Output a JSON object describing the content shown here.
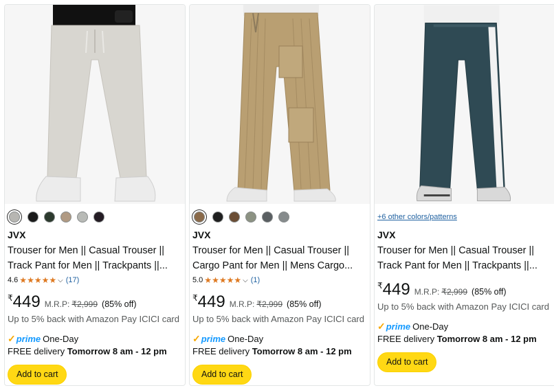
{
  "products": [
    {
      "brand": "JVX",
      "title": "Trouser for Men || Casual Trouser || Track Pant for Men || Trackpants ||...",
      "swatches": [
        "#b7b6b2",
        "#1a1a1a",
        "#2c3a2e",
        "#b09a83",
        "#b8bab6",
        "#241c24"
      ],
      "rating": "4.6",
      "reviews": "(17)",
      "price_symbol": "₹",
      "price": "449",
      "mrp_label": "M.R.P:",
      "mrp": "₹2,999",
      "discount": "(85% off)",
      "cashback": "Up to 5% back with Amazon Pay ICICI card",
      "prime_text": "prime",
      "one_day": "One-Day",
      "delivery_prefix": "FREE delivery ",
      "delivery_time": "Tomorrow 8 am - 12 pm",
      "cart_label": "Add to cart",
      "pant_color": "#d8d6d0"
    },
    {
      "brand": "JVX",
      "title": "Trouser for Men || Casual Trouser || Cargo Pant for Men || Mens Cargo...",
      "swatches": [
        "#8a6a4a",
        "#1f1f1f",
        "#6b4e35",
        "#8c9283",
        "#5a5f62",
        "#868b8c"
      ],
      "rating": "5.0",
      "reviews": "(1)",
      "price_symbol": "₹",
      "price": "449",
      "mrp_label": "M.R.P:",
      "mrp": "₹2,999",
      "discount": "(85% off)",
      "cashback": "Up to 5% back with Amazon Pay ICICI card",
      "prime_text": "prime",
      "one_day": "One-Day",
      "delivery_prefix": "FREE delivery ",
      "delivery_time": "Tomorrow 8 am - 12 pm",
      "cart_label": "Add to cart",
      "pant_color": "#b99f72"
    },
    {
      "brand": "JVX",
      "title": "Trouser for Men || Casual Trouser || Track Pant for Men || Trackpants ||...",
      "more_colors": "+6 other colors/patterns",
      "price_symbol": "₹",
      "price": "449",
      "mrp_label": "M.R.P:",
      "mrp": "₹2,999",
      "discount": "(85% off)",
      "cashback": "Up to 5% back with Amazon Pay ICICI card",
      "prime_text": "prime",
      "one_day": "One-Day",
      "delivery_prefix": "FREE delivery ",
      "delivery_time": "Tomorrow 8 am - 12 pm",
      "cart_label": "Add to cart",
      "pant_color": "#2f4a54"
    }
  ],
  "colors": {
    "star": "#de7921",
    "link": "#2162a1",
    "prime": "#1399ff",
    "button": "#ffd814"
  },
  "icons": [
    "star-icon",
    "chevron-down-icon",
    "prime-check-icon"
  ]
}
